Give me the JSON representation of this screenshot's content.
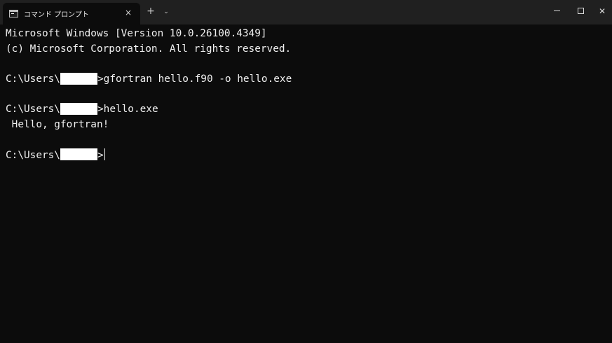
{
  "window": {
    "tab_title": "コマンド プロンプト",
    "tab_close": "×",
    "new_tab": "+",
    "dropdown": "⌄",
    "minimize_icon": "minimize-icon",
    "maximize_icon": "maximize-icon",
    "close_icon": "close-icon",
    "close_glyph": "✕"
  },
  "terminal": {
    "header_line1": "Microsoft Windows [Version 10.0.26100.4349]",
    "header_line2": "(c) Microsoft Corporation. All rights reserved.",
    "prompt_prefix": "C:\\Users\\",
    "prompt_suffix": ">",
    "command1": "gfortran hello.f90 -o hello.exe",
    "command2": "hello.exe",
    "output1": " Hello, gfortran!",
    "command3": ""
  },
  "colors": {
    "background": "#0c0c0c",
    "titlebar": "#202020",
    "text": "#f0f0f0"
  }
}
